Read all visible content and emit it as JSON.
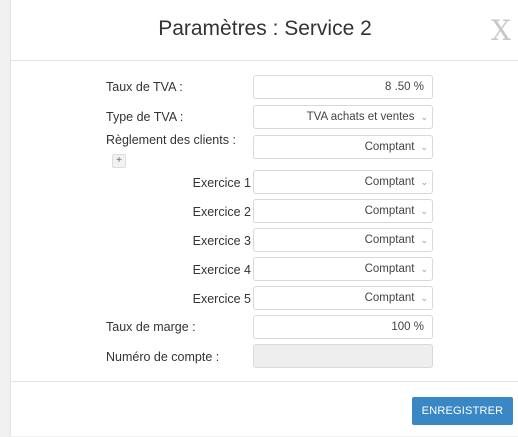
{
  "dialog": {
    "title": "Paramètres : Service 2",
    "close_label": "X"
  },
  "form": {
    "tva_rate_label": "Taux de TVA :",
    "tva_rate_value": "8 .50 %",
    "tva_type_label": "Type de TVA :",
    "tva_type_value": "TVA achats et ventes",
    "clients_label": "Règlement des clients :",
    "expand_label": "+",
    "clients_value": "Comptant",
    "exercises": [
      {
        "label": "Exercice 1",
        "value": "Comptant"
      },
      {
        "label": "Exercice 2",
        "value": "Comptant"
      },
      {
        "label": "Exercice 3",
        "value": "Comptant"
      },
      {
        "label": "Exercice 4",
        "value": "Comptant"
      },
      {
        "label": "Exercice 5",
        "value": "Comptant"
      }
    ],
    "margin_label": "Taux de marge :",
    "margin_value": "100 %",
    "account_label": "Numéro de compte :",
    "account_value": ""
  },
  "footer": {
    "save_label": "ENREGISTRER"
  }
}
